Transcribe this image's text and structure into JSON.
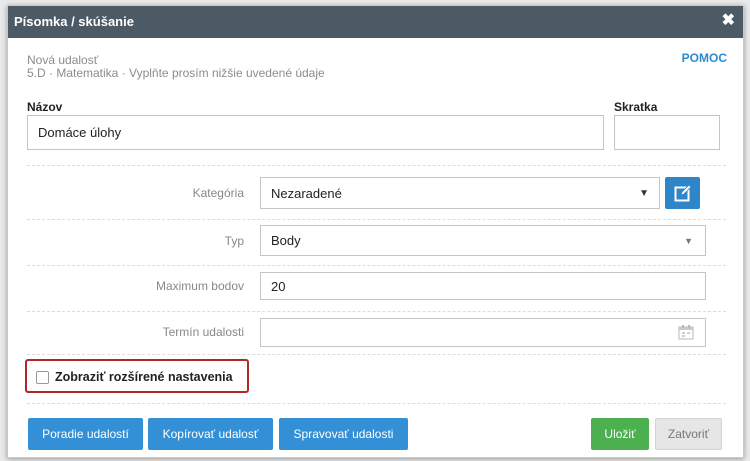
{
  "dialog": {
    "title": "Písomka / skúšanie",
    "close_icon": "close-icon",
    "subtitle_line1": "Nová udalosť",
    "subtitle_line2": "5.D · Matematika · Vyplňte prosím nižšie uvedené údaje",
    "help_label": "POMOC"
  },
  "form": {
    "name_label": "Názov",
    "name_value": "Domáce úlohy",
    "short_label": "Skratka",
    "short_value": "",
    "category_label": "Kategória",
    "category_value": "Nezaradené",
    "type_label": "Typ",
    "type_value": "Body",
    "max_points_label": "Maximum bodov",
    "max_points_value": "20",
    "deadline_label": "Termín udalosti",
    "deadline_value": "",
    "advanced_label": "Zobraziť rozšírené nastavenia",
    "advanced_checked": false
  },
  "buttons": {
    "order": "Poradie udalostí",
    "copy": "Kopírovať udalosť",
    "manage": "Spravovať udalosti",
    "save": "Uložiť",
    "close": "Zatvoriť"
  },
  "colors": {
    "titlebar": "#4b5a65",
    "accent": "#3390d6",
    "save": "#4caf50",
    "highlight": "#b0262b"
  }
}
